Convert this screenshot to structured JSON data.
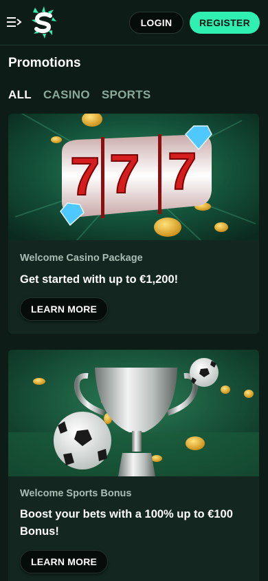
{
  "header": {
    "menu_icon": "menu-arrow-icon",
    "logo_icon": "brand-s-logo-icon",
    "login_label": "LOGIN",
    "register_label": "REGISTER",
    "accent_color": "#2ff0b0"
  },
  "page": {
    "title": "Promotions"
  },
  "tabs": [
    {
      "label": "ALL",
      "active": true
    },
    {
      "label": "CASINO",
      "active": false
    },
    {
      "label": "SPORTS",
      "active": false
    }
  ],
  "promotions": [
    {
      "image": "slot-777-reels-image",
      "subtitle": "Welcome Casino Package",
      "title": "Get started with up to €1,200!",
      "button_label": "LEARN MORE"
    },
    {
      "image": "trophy-footballs-image",
      "subtitle": "Welcome Sports Bonus",
      "title": "Boost your bets with a 100% up to €100 Bonus!",
      "button_label": "LEARN MORE"
    }
  ]
}
